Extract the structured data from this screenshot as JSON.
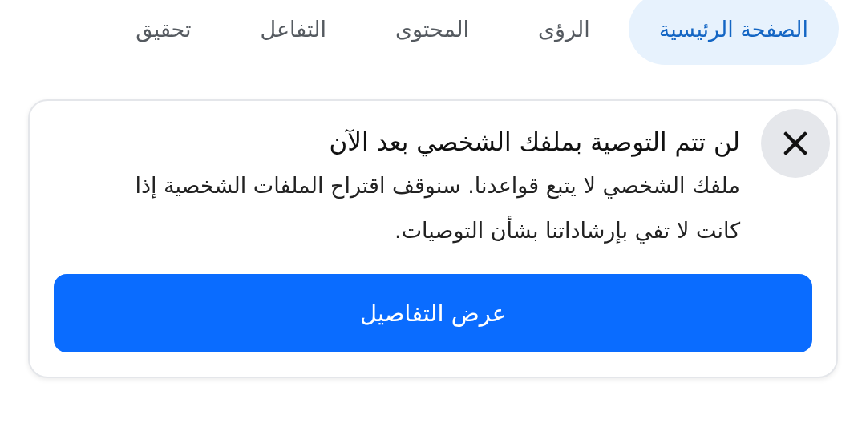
{
  "tabs": [
    {
      "label": "الصفحة الرئيسية",
      "selected": true
    },
    {
      "label": "الرؤى",
      "selected": false
    },
    {
      "label": "المحتوى",
      "selected": false
    },
    {
      "label": "التفاعل",
      "selected": false
    },
    {
      "label": "تحقيق",
      "selected": false
    }
  ],
  "notice": {
    "title": "لن تتم التوصية بملفك الشخصي بعد الآن",
    "body": "ملفك الشخصي لا يتبع قواعدنا. سنوقف اقتراح الملفات الشخصية إذا كانت لا تفي بإرشاداتنا بشأن التوصيات.",
    "button": "عرض التفاصيل"
  }
}
